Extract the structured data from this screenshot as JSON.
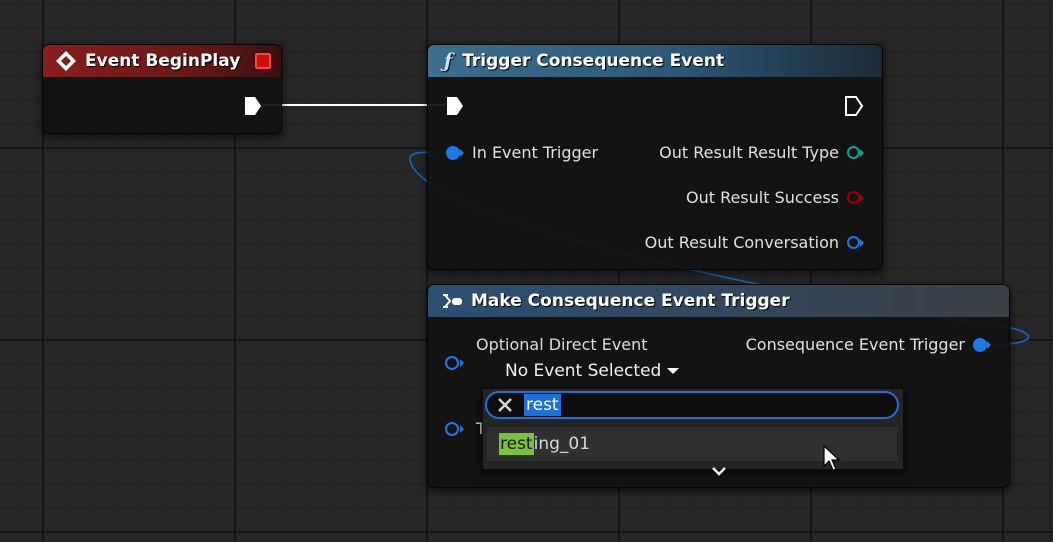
{
  "colors": {
    "exec": "#ffffff",
    "struct_pin": "#1e78e6",
    "result_type_pin": "#0fa291",
    "bool_pin": "#8a0000",
    "conversation_pin": "#1e78e6",
    "event_header": "#801c1c",
    "function_header": "#2c5877",
    "make_header": "#3a4757",
    "search_highlight": "#7ac23b",
    "selected_text_bg": "#1e6fd9"
  },
  "begin_play": {
    "title": "Event BeginPlay",
    "icon": "event-diamond-icon",
    "close_icon": "red-square-icon"
  },
  "trigger_node": {
    "title": "Trigger Consequence Event",
    "icon": "function-icon",
    "inputs": [
      "In Event Trigger"
    ],
    "outputs": [
      "Out Result Result Type",
      "Out Result Success",
      "Out Result Conversation"
    ]
  },
  "make_node": {
    "title": "Make Consequence Event Trigger",
    "icon": "make-struct-icon",
    "input_label": "Optional Direct Event",
    "dropdown_value": "No Event Selected",
    "output_label": "Consequence Event Trigger",
    "hidden_pin_initial": "T"
  },
  "search_popup": {
    "query": "rest",
    "clear_icon": "close-icon",
    "results": [
      {
        "match": "rest",
        "rest": "ing_01"
      }
    ],
    "expand_icon": "chevron-down-icon"
  }
}
